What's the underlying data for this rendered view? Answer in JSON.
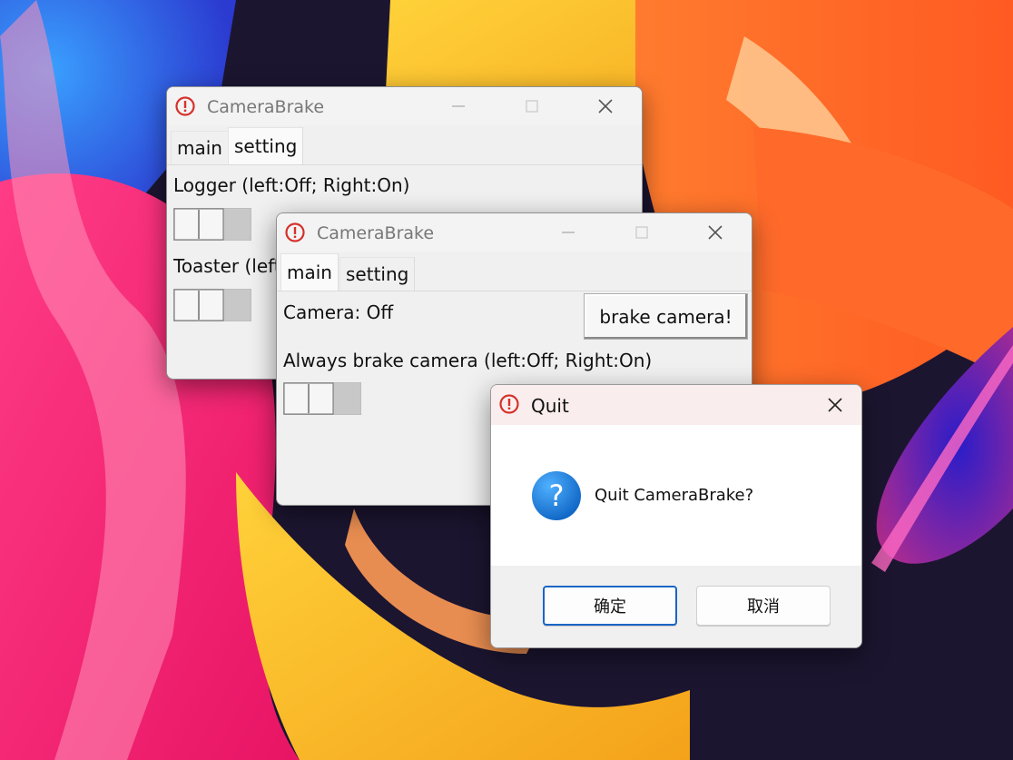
{
  "windows": {
    "back": {
      "title": "CameraBrake",
      "tabs": [
        "main",
        "setting"
      ],
      "active_tab": "setting",
      "logger_label": "Logger (left:Off; Right:On)",
      "toaster_label": "Toaster (left:Off; Right:On)"
    },
    "front": {
      "title": "CameraBrake",
      "tabs": [
        "main",
        "setting"
      ],
      "active_tab": "main",
      "camera_status": "Camera: Off",
      "brake_button": "brake camera!",
      "always_brake_label": "Always brake camera (left:Off; Right:On)"
    }
  },
  "dialog": {
    "title": "Quit",
    "message": "Quit CameraBrake?",
    "ok_label": "确定",
    "cancel_label": "取消"
  },
  "icons": {
    "app": "alert-circle-icon",
    "question": "question-icon",
    "minimize": "minimize-icon",
    "maximize": "maximize-icon",
    "close": "close-icon"
  },
  "colors": {
    "app_icon_red": "#d4322c",
    "question_blue": "#1678d2",
    "primary_border": "#1a66c4"
  }
}
